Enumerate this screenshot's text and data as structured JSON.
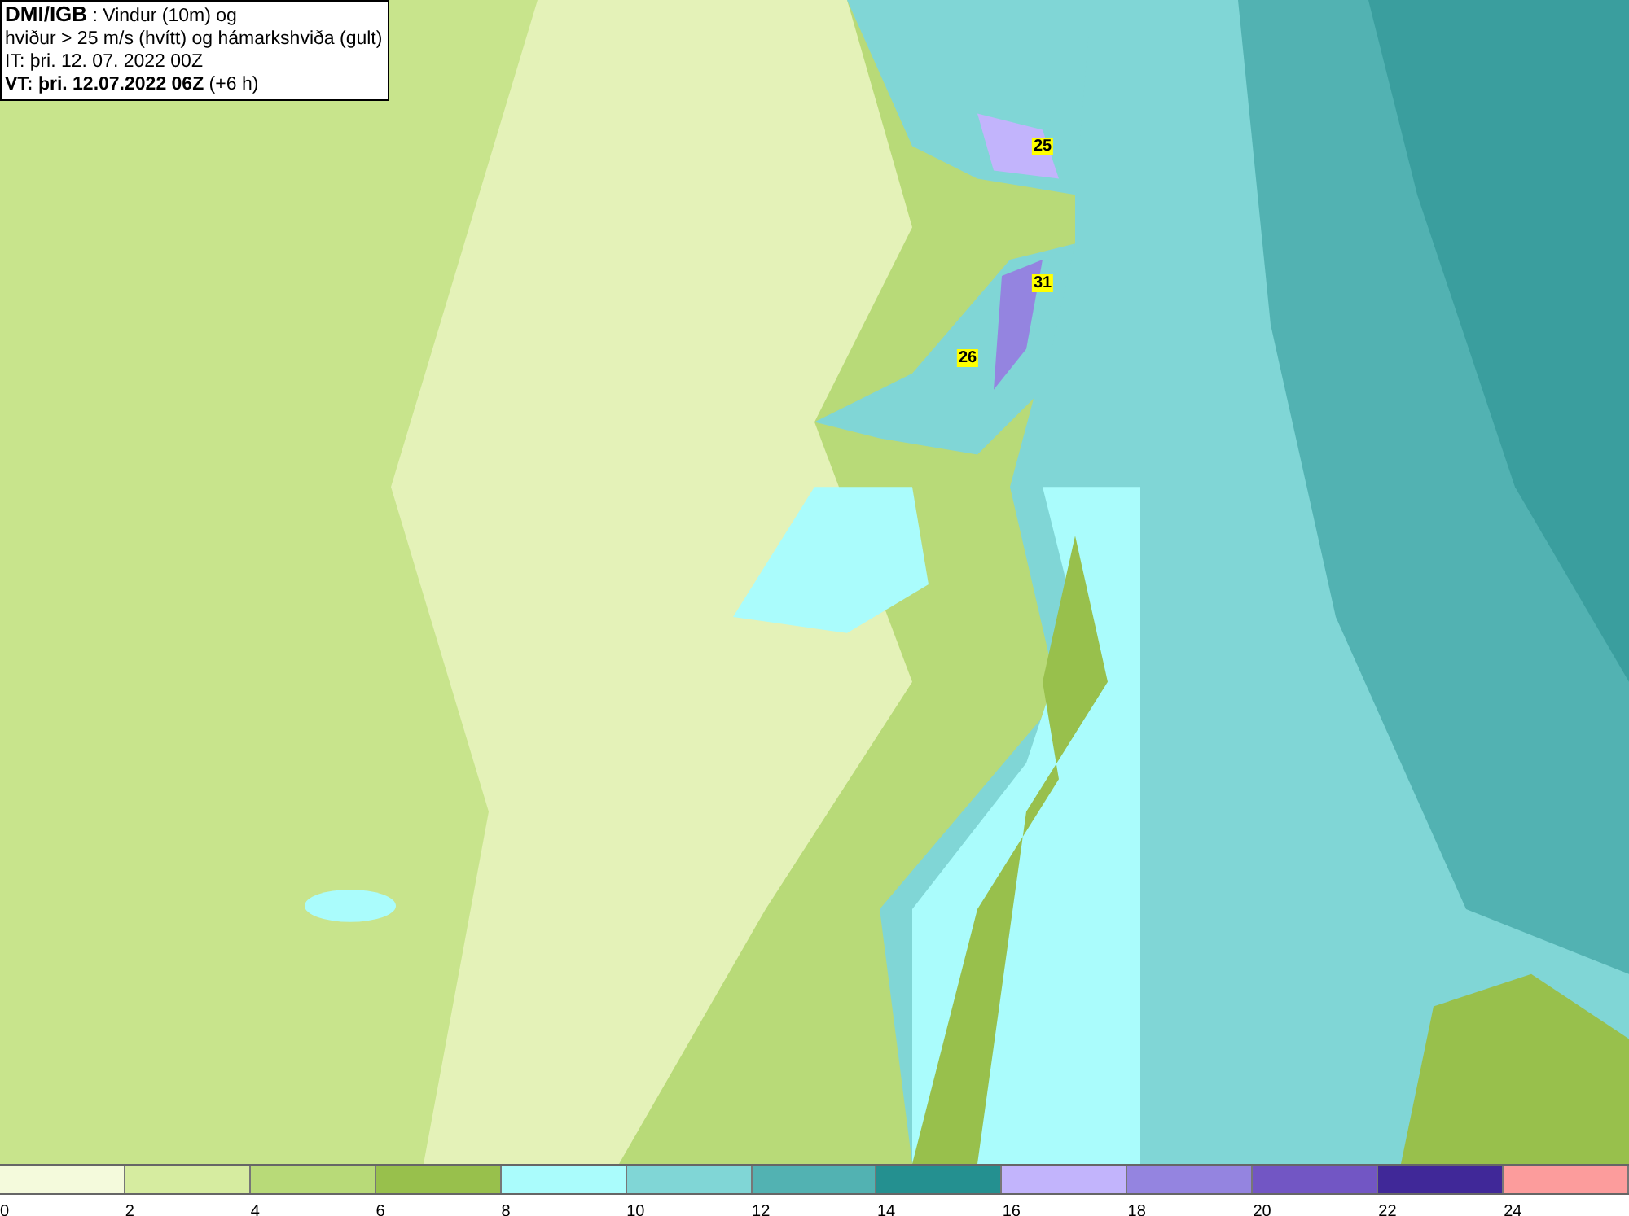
{
  "title_box": {
    "lines": [
      "**DMI/IGB** : Vindur (10m) og",
      "hviður > 25 m/s (hvítt) og hámarkshviða (gult)",
      "IT: þri. 12. 07. 2022 00Z",
      "**VT: þri. 12.07.2022 06Z** (+6 h)"
    ]
  },
  "map": {
    "gust_labels": [
      {
        "text": "25"
      },
      {
        "text": "31"
      },
      {
        "text": "26"
      }
    ]
  },
  "legend": {
    "segments": [
      {
        "color": "#f4fadc",
        "label": "0"
      },
      {
        "color": "#d6eca0",
        "label": "2"
      },
      {
        "color": "#b8da78",
        "label": "4"
      },
      {
        "color": "#98c04c",
        "label": "6"
      },
      {
        "color": "#aafcfc",
        "label": "8"
      },
      {
        "color": "#80d6d6",
        "label": "10"
      },
      {
        "color": "#52b2b2",
        "label": "12"
      },
      {
        "color": "#249090",
        "label": "14"
      },
      {
        "color": "#c2b4fc",
        "label": "16"
      },
      {
        "color": "#9484e0",
        "label": "18"
      },
      {
        "color": "#7256c4",
        "label": "20"
      },
      {
        "color": "#402898",
        "label": "22"
      },
      {
        "color": "#fc9c9c",
        "label": "24"
      }
    ]
  }
}
